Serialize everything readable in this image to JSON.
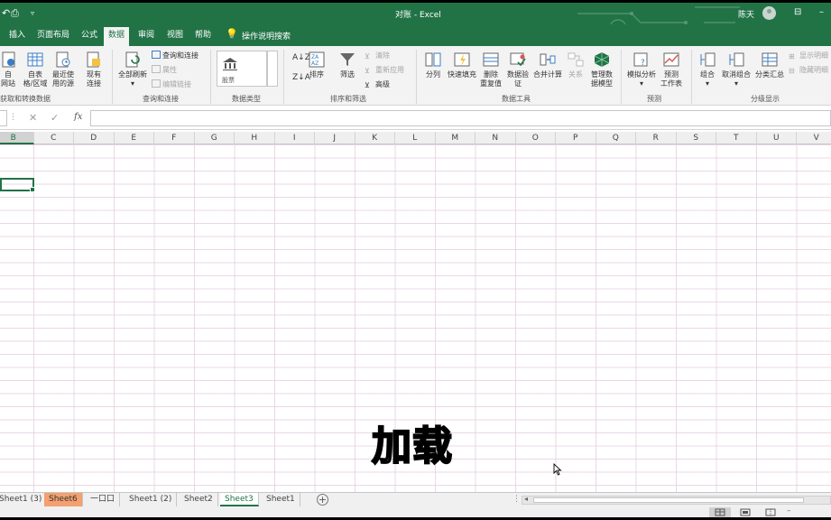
{
  "window": {
    "title": "对账 - Excel",
    "user": "陈天"
  },
  "ribbon_tabs": [
    "插入",
    "页面布局",
    "公式",
    "数据",
    "审阅",
    "视图",
    "帮助"
  ],
  "active_tab": "数据",
  "tell_me": "操作说明搜索",
  "ribbon": {
    "get_data": {
      "from_web": "自\n网站",
      "from_table": "自表\n格/区域",
      "recent_sources": "最近使\n用的源",
      "existing_conn": "现有\n连接",
      "group_label": "获取和转换数据"
    },
    "queries": {
      "refresh_all": "全部刷新",
      "queries_conn": "查询和连接",
      "properties": "属性",
      "edit_links": "编辑链接",
      "group_label": "查询和连接"
    },
    "data_types": {
      "stocks": "股票",
      "group_label": "数据类型"
    },
    "sort_filter": {
      "sort": "排序",
      "filter": "筛选",
      "clear": "清除",
      "reapply": "重新应用",
      "advanced": "高级",
      "group_label": "排序和筛选"
    },
    "data_tools": {
      "text_to_columns": "分列",
      "flash_fill": "快速填充",
      "remove_duplicates": "删除\n重复值",
      "data_validation": "数据验\n证",
      "consolidate": "合并计算",
      "relationships": "关系",
      "manage_model": "管理数\n据模型",
      "group_label": "数据工具"
    },
    "forecast": {
      "what_if": "模拟分析",
      "forecast_sheet": "预测\n工作表",
      "group_label": "预测"
    },
    "outline": {
      "group": "组合",
      "ungroup": "取消组合",
      "subtotal": "分类汇总",
      "show_detail": "显示明细",
      "hide_detail": "隐藏明细",
      "group_label": "分级显示"
    }
  },
  "formula_bar": {
    "cancel": "✕",
    "enter": "✓",
    "fx": "fx",
    "value": ""
  },
  "columns": [
    "B",
    "C",
    "D",
    "E",
    "F",
    "G",
    "H",
    "I",
    "J",
    "K",
    "L",
    "M",
    "N",
    "O",
    "P",
    "Q",
    "R",
    "S",
    "T",
    "U",
    "V"
  ],
  "selected_column": "B",
  "overlay_text": "加载",
  "sheets": [
    {
      "name": "Sheet1 (3)",
      "style": "normal"
    },
    {
      "name": "Sheet6",
      "style": "orange"
    },
    {
      "name": "一口口",
      "style": "normal"
    },
    {
      "name": "Sheet1 (2)",
      "style": "normal"
    },
    {
      "name": "Sheet2",
      "style": "normal"
    },
    {
      "name": "Sheet3",
      "style": "active"
    },
    {
      "name": "Sheet1",
      "style": "normal"
    }
  ],
  "colors": {
    "excel_green": "#217346",
    "sheet_tab_orange": "#f4a070",
    "grid_line": "#e1c8dc"
  }
}
